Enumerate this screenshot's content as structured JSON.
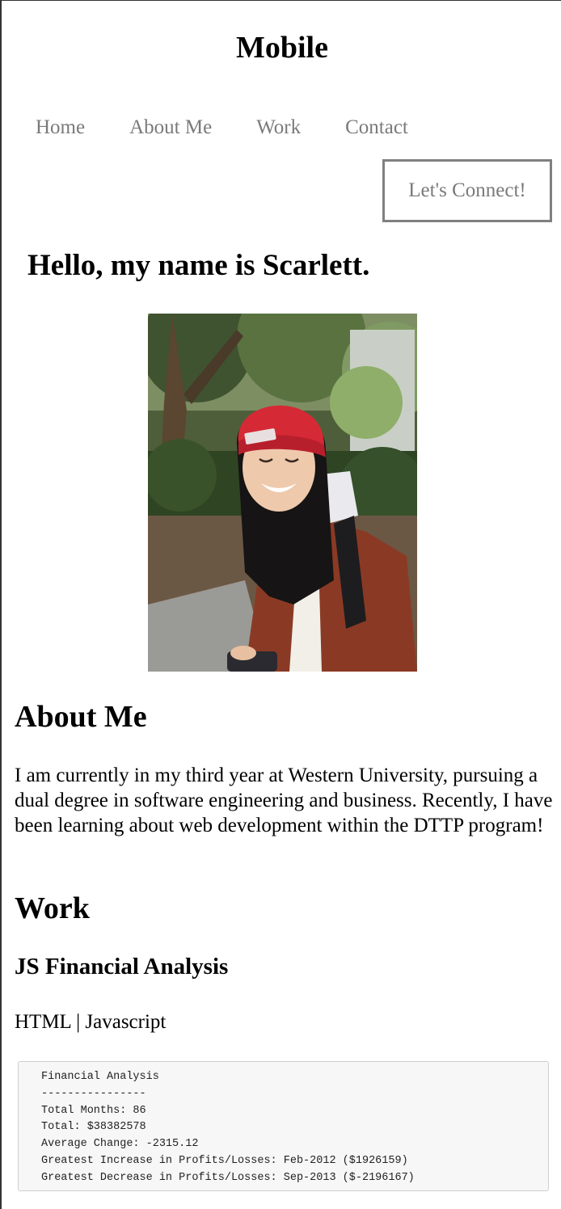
{
  "header": {
    "title": "Mobile"
  },
  "nav": {
    "items": [
      {
        "label": "Home"
      },
      {
        "label": "About Me"
      },
      {
        "label": "Work"
      },
      {
        "label": "Contact"
      }
    ],
    "connect_label": "Let's Connect!"
  },
  "hero": {
    "greeting": "Hello, my name is Scarlett."
  },
  "about": {
    "heading": "About Me",
    "text": "I am currently in my third year at Western University, pursuing a dual degree in software engineering and business. Recently, I have been learning about web development within the DTTP program!"
  },
  "work": {
    "heading": "Work",
    "project": {
      "title": "JS Financial Analysis",
      "tech": "HTML | Javascript",
      "output": [
        "Financial Analysis",
        "----------------",
        "Total Months: 86",
        "Total: $38382578",
        "Average Change: -2315.12",
        "Greatest Increase in Profits/Losses: Feb-2012 ($1926159)",
        "Greatest Decrease in Profits/Losses: Sep-2013 ($-2196167)"
      ]
    }
  },
  "colors": {
    "nav_text": "#7a7a7a",
    "button_border": "#808080",
    "code_background": "#f7f7f7"
  }
}
